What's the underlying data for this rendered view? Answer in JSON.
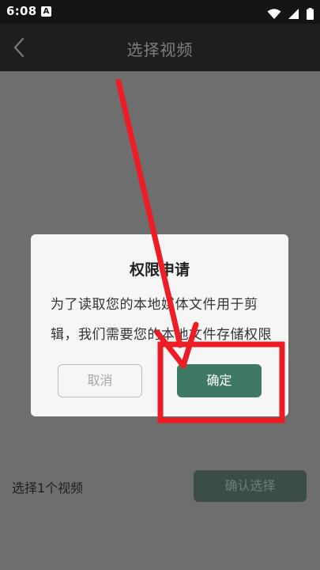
{
  "status_bar": {
    "time": "6:08",
    "notification_icon": "A",
    "icons": [
      "wifi-icon",
      "signal-icon",
      "battery-icon"
    ]
  },
  "navbar": {
    "title": "选择视频",
    "back_icon": "chevron-left-icon"
  },
  "dialog": {
    "title": "权限申请",
    "message_line1": "为了读取您的本地媒体文件用于剪",
    "message_line2": "辑，我们需要您的本地文件存储权限",
    "cancel_label": "取消",
    "confirm_label": "确定"
  },
  "footer": {
    "selection_count": "选择1个视频",
    "confirm_selection_label": "确认选择"
  },
  "colors": {
    "overlay": "#6e6e6e",
    "accent_green": "#3f7863",
    "annotation_red": "#ee1c25"
  }
}
